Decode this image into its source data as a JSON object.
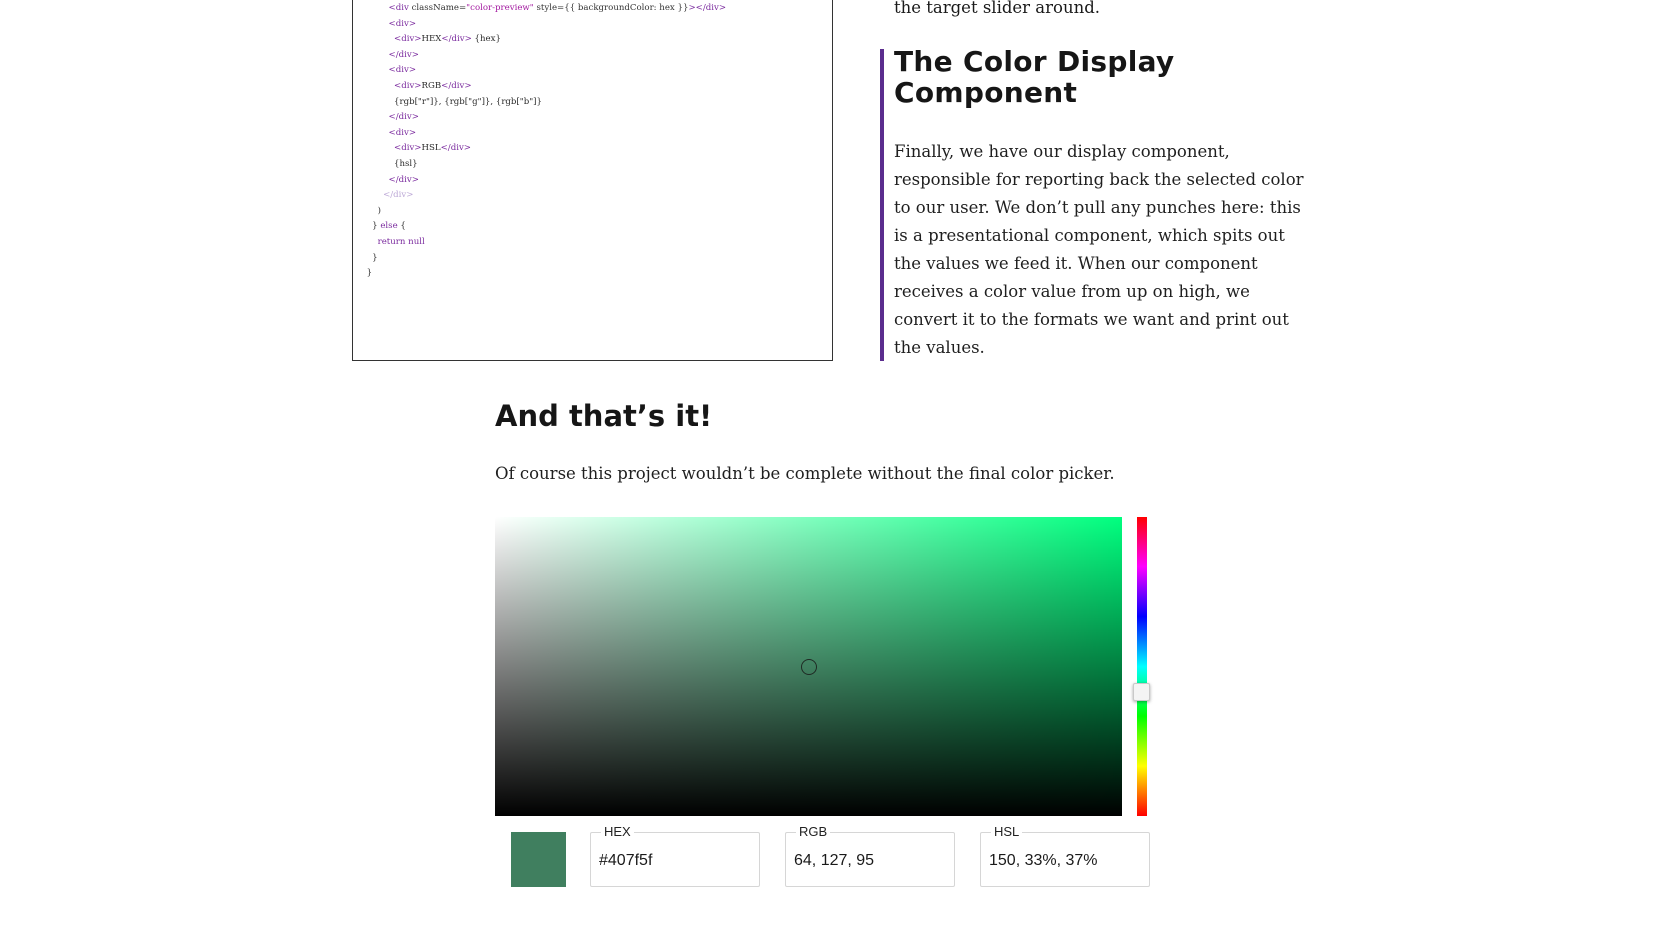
{
  "code_block": {
    "lines": [
      [
        {
          "t": "        "
        },
        {
          "t": "<div ",
          "c": "c-tag"
        },
        {
          "t": "className=",
          "c": "c-attr"
        },
        {
          "t": "\"color-preview\"",
          "c": "c-str"
        },
        {
          "t": " style={{ backgroundColor: hex }}",
          "c": "c-attr"
        },
        {
          "t": "></div>",
          "c": "c-tag"
        }
      ],
      [
        {
          "t": "        "
        },
        {
          "t": "<div>",
          "c": "c-tag"
        }
      ],
      [
        {
          "t": "          "
        },
        {
          "t": "<div>",
          "c": "c-tag"
        },
        {
          "t": "HEX",
          "c": "c-plain"
        },
        {
          "t": "</div>",
          "c": "c-tag"
        },
        {
          "t": " {hex}",
          "c": "c-plain"
        }
      ],
      [
        {
          "t": "        "
        },
        {
          "t": "</div>",
          "c": "c-tag"
        }
      ],
      [
        {
          "t": "        "
        },
        {
          "t": "<div>",
          "c": "c-tag"
        }
      ],
      [
        {
          "t": "          "
        },
        {
          "t": "<div>",
          "c": "c-tag"
        },
        {
          "t": "RGB",
          "c": "c-plain"
        },
        {
          "t": "</div>",
          "c": "c-tag"
        }
      ],
      [
        {
          "t": "          "
        },
        {
          "t": "{rgb[\"r\"]}, {rgb[\"g\"]}, {rgb[\"b\"]}",
          "c": "c-plain"
        }
      ],
      [
        {
          "t": "        "
        },
        {
          "t": "</div>",
          "c": "c-tag"
        }
      ],
      [
        {
          "t": "        "
        },
        {
          "t": "<div>",
          "c": "c-tag"
        }
      ],
      [
        {
          "t": "          "
        },
        {
          "t": "<div>",
          "c": "c-tag"
        },
        {
          "t": "HSL",
          "c": "c-plain"
        },
        {
          "t": "</div>",
          "c": "c-tag"
        }
      ],
      [
        {
          "t": "          "
        },
        {
          "t": "{hsl}",
          "c": "c-plain"
        }
      ],
      [
        {
          "t": "        "
        },
        {
          "t": "</div>",
          "c": "c-tag"
        }
      ],
      [
        {
          "t": "      "
        },
        {
          "t": "</div>",
          "c": "c-faded"
        }
      ],
      [
        {
          "t": "    "
        },
        {
          "t": ")",
          "c": "c-plain"
        }
      ],
      [
        {
          "t": "  "
        },
        {
          "t": "} ",
          "c": "c-plain"
        },
        {
          "t": "else",
          "c": "c-kw"
        },
        {
          "t": " {",
          "c": "c-plain"
        }
      ],
      [
        {
          "t": "    "
        },
        {
          "t": "return null",
          "c": "c-kw"
        }
      ],
      [
        {
          "t": "  "
        },
        {
          "t": "}",
          "c": "c-plain"
        }
      ],
      [
        {
          "t": "}",
          "c": "c-plain"
        }
      ]
    ]
  },
  "side_section": {
    "lead_in": "the target slider around.",
    "title": "The Color Display Component",
    "body": "Finally, we have our display component, responsible for reporting back the selected color to our user. We don’t pull any punches here: this is a presentational component, which spits out the values we feed it. When our component receives a color value from up on high, we convert it to the formats we want and print out the values."
  },
  "main_section": {
    "title": "And that’s it!",
    "paragraph": "Of course this project wouldn’t be complete without the final color picker."
  },
  "color_picker": {
    "hue_color": "#00ff7f",
    "selected_color": "#407f5f",
    "saturation_fraction": 0.5,
    "value_fraction": 0.5,
    "hue_fraction": 0.583,
    "fields": {
      "hex": {
        "label": "HEX",
        "value": "#407f5f"
      },
      "rgb": {
        "label": "RGB",
        "value": "64, 127, 95"
      },
      "hsl": {
        "label": "HSL",
        "value": "150, 33%, 37%"
      }
    }
  }
}
